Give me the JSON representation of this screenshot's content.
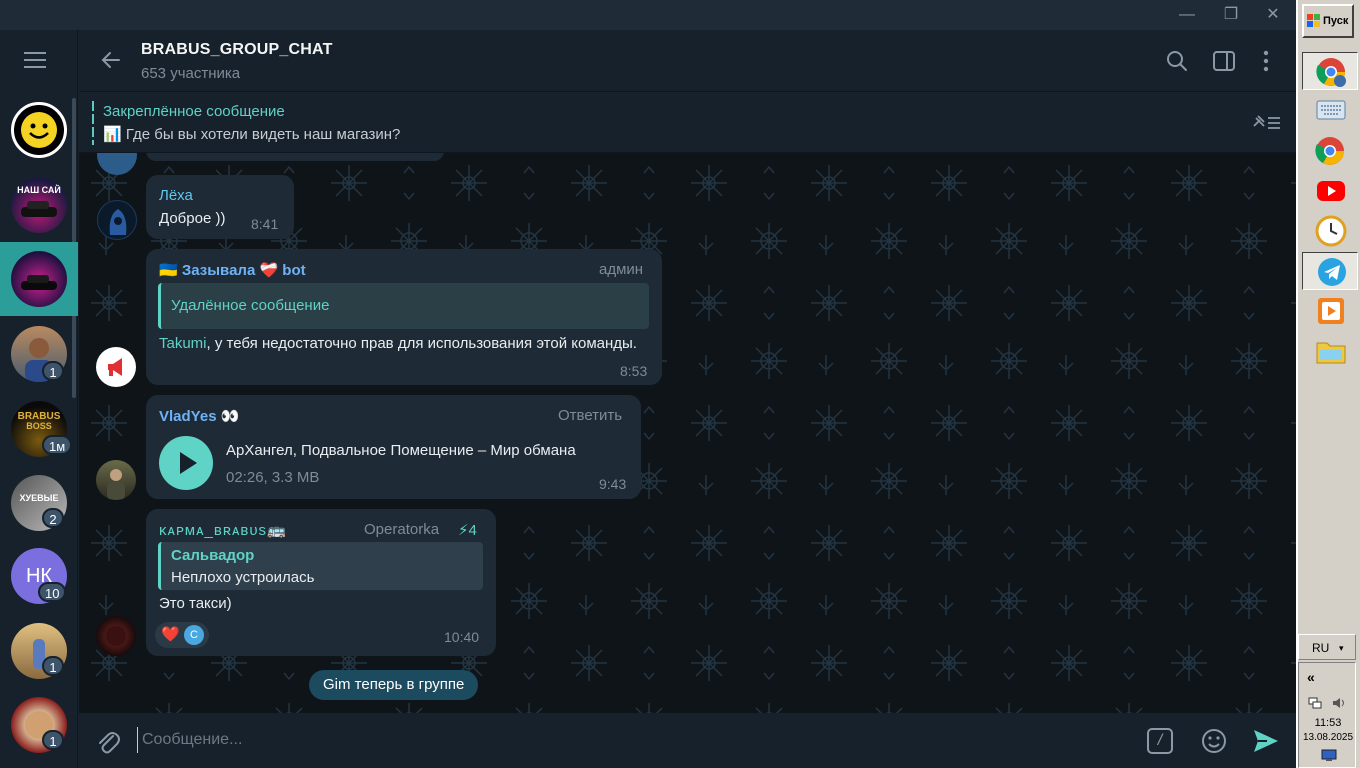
{
  "window": {
    "controls": {
      "minimize": "—",
      "restore": "❐",
      "close": "✕"
    }
  },
  "chatlist": {
    "badges": [
      "1",
      "1м",
      "2",
      "10",
      "1",
      "1"
    ],
    "initials_avatar": "НК"
  },
  "header": {
    "title": "BRABUS_GROUP_CHAT",
    "subtitle": "653 участника"
  },
  "pinned": {
    "title": "Закреплённое сообщение",
    "emoji": "📊",
    "text": "Где бы вы хотели видеть наш магазин?"
  },
  "messages": [
    {
      "sender": "Лёха",
      "sender_color": "#5fc8f0",
      "text": "Доброе ))",
      "time": "8:41"
    },
    {
      "sender_flag": "🇺🇦",
      "sender": "Зазывала ❤️‍🩹 bot",
      "sender_color": "#6fb3f5",
      "role": "админ",
      "reply_text": "Удалённое сообщение",
      "mention": "Takumi",
      "text": ", у тебя недостаточно прав для использования этой команды.",
      "time": "8:53"
    },
    {
      "sender": "VladYes 👀",
      "sender_color": "#6fb3f5",
      "action": "Ответить",
      "audio_title": "АрХангел, Подвальное Помещение – Мир обмана",
      "audio_meta": "02:26, 3.3 MB",
      "time": "9:43"
    },
    {
      "sender": "ᴋᴀᴘᴍᴀ_ʙʀᴀʙᴜs🚌",
      "sender_color": "#5fd3c6",
      "rank": "Operatorka",
      "boost": "⚡4",
      "reply_sender": "Сальвадор",
      "reply_text": "Неплохо устроилась",
      "text": "Это такси)",
      "reaction": "❤️",
      "reaction_user": "C",
      "time": "10:40"
    }
  ],
  "service_message": "Gim теперь в группе",
  "composer": {
    "placeholder": "Сообщение...",
    "command_icon": "/"
  },
  "taskbar": {
    "start_label": "Пуск",
    "language": "RU",
    "time": "11:53",
    "date": "13.08.2025",
    "collapse": "«"
  },
  "icons": [
    "menu-icon",
    "back-arrow-icon",
    "search-icon",
    "sidebar-toggle-icon",
    "more-vert-icon",
    "pin-list-icon",
    "play-icon",
    "attach-icon",
    "emoji-icon",
    "send-icon"
  ]
}
